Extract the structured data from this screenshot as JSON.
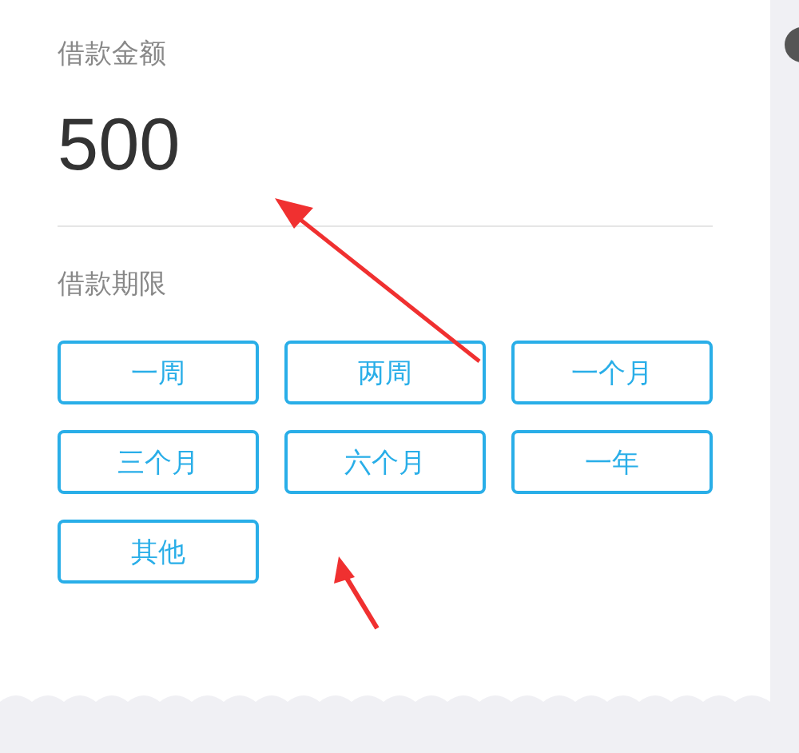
{
  "amount": {
    "label": "借款金额",
    "value": "500"
  },
  "term": {
    "label": "借款期限",
    "options": [
      {
        "label": "一周",
        "selected": false
      },
      {
        "label": "两周",
        "selected": false
      },
      {
        "label": "一个月",
        "selected": false
      },
      {
        "label": "三个月",
        "selected": false
      },
      {
        "label": "六个月",
        "selected": false
      },
      {
        "label": "一年",
        "selected": false
      },
      {
        "label": "其他",
        "selected": false
      }
    ]
  }
}
